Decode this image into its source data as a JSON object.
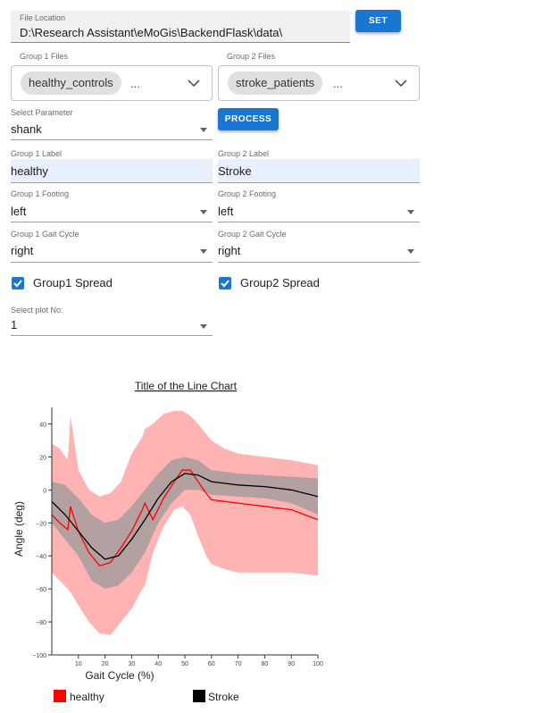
{
  "file_location": {
    "label": "File Location",
    "value": "D:\\Research Assistant\\eMoGis\\BackendFlask\\data\\",
    "set_button": "SET"
  },
  "group1_files": {
    "label": "Group 1 Files",
    "chip": "healthy_controls",
    "more": "..."
  },
  "group2_files": {
    "label": "Group 2 Files",
    "chip": "stroke_patients",
    "more": "..."
  },
  "select_parameter": {
    "label": "Select Parameter",
    "value": "shank"
  },
  "process_button": "PROCESS",
  "group1_label": {
    "label": "Group 1 Label",
    "value": "healthy"
  },
  "group2_label": {
    "label": "Group 2 Label",
    "value": "Stroke"
  },
  "group1_footing": {
    "label": "Group 1 Footing",
    "value": "left"
  },
  "group2_footing": {
    "label": "Group 2 Footing",
    "value": "left"
  },
  "group1_gait": {
    "label": "Group 1 Gait Cycle",
    "value": "right"
  },
  "group2_gait": {
    "label": "Group 2 Gait Cycle",
    "value": "right"
  },
  "group1_spread": {
    "label": "Group1 Spread",
    "checked": true
  },
  "group2_spread": {
    "label": "Group2 Spread",
    "checked": true
  },
  "plot_no": {
    "label": "Select plot No:",
    "value": "1"
  },
  "colors": {
    "accent": "#1976d2",
    "healthy": "#ff0000",
    "healthy_band": "#ffb3b3",
    "stroke": "#000000",
    "stroke_band": "#999999"
  },
  "chart_data": {
    "type": "line",
    "title": "Title of the Line Chart",
    "xlabel": "Gait Cycle (%)",
    "ylabel": "Angle (deg)",
    "xlim": [
      0,
      100
    ],
    "ylim": [
      -100,
      50
    ],
    "xticks": [
      "10",
      "20",
      "30",
      "40",
      "50",
      "60",
      "70",
      "80",
      "90",
      "100"
    ],
    "yticks": [
      "40",
      "20",
      "0",
      "−20",
      "−40",
      "−60",
      "−80",
      "−100"
    ],
    "legend": [
      "healthy",
      "Stroke"
    ],
    "legend_position": "bottom",
    "series": [
      {
        "name": "healthy",
        "color": "#ff0000",
        "x": [
          0,
          3,
          6,
          7,
          10,
          14,
          18,
          22,
          26,
          30,
          34,
          35,
          38,
          42,
          46,
          49,
          52,
          55,
          58,
          60,
          65,
          70,
          80,
          90,
          100
        ],
        "y": [
          -15,
          -20,
          -24,
          -10,
          -25,
          -38,
          -46,
          -44,
          -35,
          -25,
          -12,
          -8,
          -18,
          -5,
          5,
          12,
          12,
          5,
          -2,
          -6,
          -7,
          -8,
          -10,
          -12,
          -18
        ],
        "band_upper": [
          28,
          25,
          18,
          45,
          12,
          0,
          -4,
          -2,
          5,
          22,
          32,
          37,
          40,
          46,
          48,
          48,
          45,
          40,
          34,
          30,
          25,
          22,
          20,
          18,
          15
        ],
        "band_lower": [
          -50,
          -55,
          -60,
          -62,
          -70,
          -80,
          -87,
          -88,
          -80,
          -72,
          -60,
          -58,
          -38,
          -22,
          -12,
          -10,
          -15,
          -28,
          -40,
          -45,
          -48,
          -50,
          -50,
          -50,
          -52
        ]
      },
      {
        "name": "Stroke",
        "color": "#000000",
        "x": [
          0,
          5,
          10,
          15,
          20,
          25,
          30,
          35,
          40,
          45,
          50,
          55,
          60,
          70,
          80,
          90,
          100
        ],
        "y": [
          -7,
          -15,
          -25,
          -35,
          -42,
          -40,
          -30,
          -18,
          -5,
          5,
          10,
          9,
          5,
          3,
          2,
          0,
          -4
        ],
        "band_upper": [
          5,
          3,
          -5,
          -15,
          -20,
          -18,
          -10,
          0,
          10,
          18,
          20,
          18,
          12,
          10,
          9,
          8,
          7
        ],
        "band_lower": [
          -20,
          -30,
          -40,
          -55,
          -60,
          -58,
          -50,
          -38,
          -20,
          -8,
          0,
          0,
          -3,
          -4,
          -5,
          -8,
          -15
        ]
      }
    ]
  }
}
